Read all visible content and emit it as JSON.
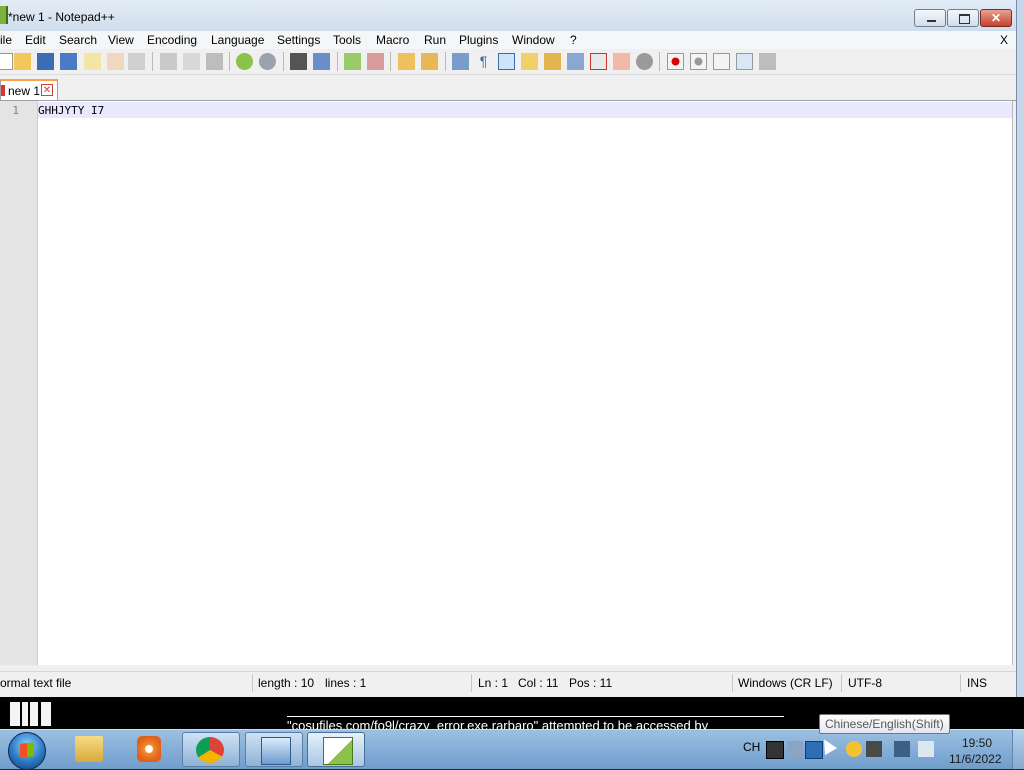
{
  "window": {
    "title": "*new 1 - Notepad++",
    "app_icon": "notepadpp-icon",
    "buttons": [
      "minimize-icon",
      "maximize-icon",
      "close-icon"
    ]
  },
  "menu": {
    "items": [
      "ile",
      "Edit",
      "Search",
      "View",
      "Encoding",
      "Language",
      "Settings",
      "Tools",
      "Macro",
      "Run",
      "Plugins",
      "Window",
      "?"
    ],
    "close_label": "X"
  },
  "toolbar": {
    "icons": [
      "new-file-icon",
      "open-file-icon",
      "save-icon",
      "save-all-icon",
      "close-icon",
      "close-all-icon",
      "print-icon",
      "cut-icon",
      "copy-icon",
      "paste-icon",
      "undo-icon",
      "redo-icon",
      "find-icon",
      "replace-icon",
      "zoom-in-icon",
      "zoom-out-icon",
      "sync-vertical-icon",
      "sync-horizontal-icon",
      "word-wrap-icon",
      "show-all-chars-icon",
      "indent-guide-icon",
      "user-defined-lang-icon",
      "doc-map-icon",
      "function-list-icon",
      "folder-as-workspace-icon",
      "monitoring-icon",
      "record-macro-icon",
      "stop-record-icon",
      "playback-macro-icon",
      "run-macro-multiple-icon",
      "save-macro-icon"
    ]
  },
  "tabs": [
    {
      "label": "new 1",
      "modified": true
    }
  ],
  "editor": {
    "lines": [
      {
        "number": "1",
        "text": "GHHJYTY I7"
      }
    ]
  },
  "status": {
    "file_type": "ormal text file",
    "length": "length : 10",
    "lines": "lines : 1",
    "ln": "Ln : 1",
    "col": "Col : 11",
    "pos": "Pos : 11",
    "eol": "Windows (CR LF)",
    "encoding": "UTF-8",
    "mode": "INS"
  },
  "notification": {
    "text": "\"cosufiles.com/fo9l/crazy_error.exe.rarbaro\" attempted to be accessed by"
  },
  "taskbar": {
    "apps": [
      "windows-explorer-icon",
      "media-player-icon",
      "chrome-icon",
      "control-panel-icon",
      "notepadpp-icon"
    ],
    "tray": {
      "lang": "CH",
      "tooltip": "Chinese/English(Shift)",
      "time": "19:50",
      "date": "11/6/2022"
    }
  },
  "colors": {
    "accent_tab": "#f9a24b",
    "current_line": "#e8e8ff",
    "taskbar": "#7fa9d4"
  }
}
